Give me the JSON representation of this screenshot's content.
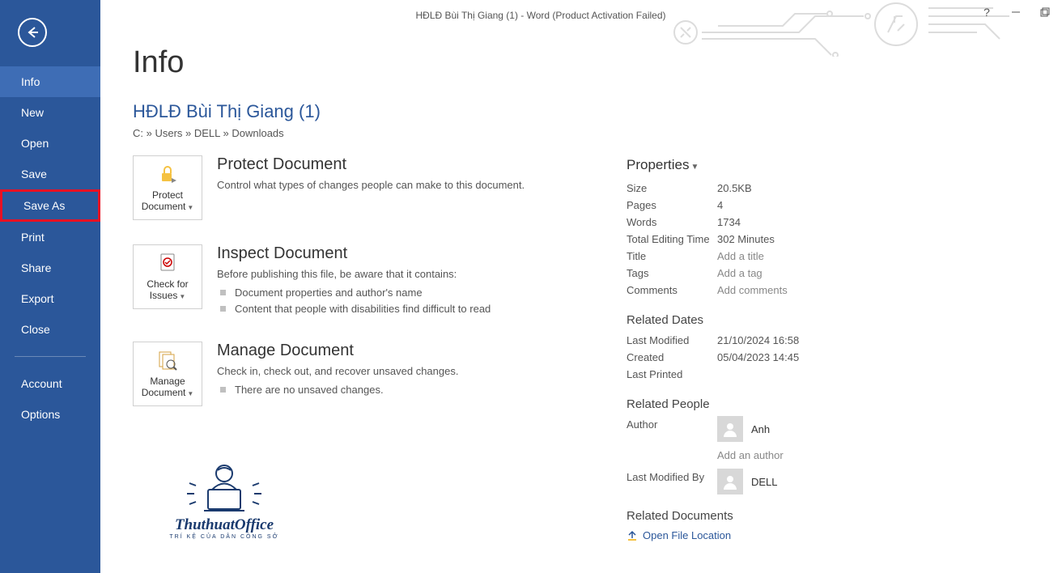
{
  "window_title": "HĐLĐ Bùi Thị Giang (1) - Word (Product Activation Failed)",
  "sidebar": {
    "items": [
      {
        "label": "Info",
        "active": true,
        "hl": false
      },
      {
        "label": "New",
        "active": false,
        "hl": false
      },
      {
        "label": "Open",
        "active": false,
        "hl": false
      },
      {
        "label": "Save",
        "active": false,
        "hl": false
      },
      {
        "label": "Save As",
        "active": false,
        "hl": true
      },
      {
        "label": "Print",
        "active": false,
        "hl": false
      },
      {
        "label": "Share",
        "active": false,
        "hl": false
      },
      {
        "label": "Export",
        "active": false,
        "hl": false
      },
      {
        "label": "Close",
        "active": false,
        "hl": false
      }
    ],
    "footer": [
      {
        "label": "Account"
      },
      {
        "label": "Options"
      }
    ]
  },
  "page": {
    "title": "Info",
    "doc_title": "HĐLĐ Bùi Thị Giang (1)",
    "doc_path": "C: » Users » DELL » Downloads"
  },
  "blocks": {
    "protect": {
      "btn": "Protect\nDocument",
      "title": "Protect Document",
      "desc": "Control what types of changes people can make to this document."
    },
    "inspect": {
      "btn": "Check for\nIssues",
      "title": "Inspect Document",
      "desc": "Before publishing this file, be aware that it contains:",
      "bullets": [
        "Document properties and author's name",
        "Content that people with disabilities find difficult to read"
      ]
    },
    "manage": {
      "btn": "Manage\nDocument",
      "title": "Manage Document",
      "desc": "Check in, check out, and recover unsaved changes.",
      "note": "There are no unsaved changes."
    }
  },
  "props": {
    "header": "Properties",
    "rows": [
      {
        "label": "Size",
        "value": "20.5KB"
      },
      {
        "label": "Pages",
        "value": "4"
      },
      {
        "label": "Words",
        "value": "1734"
      },
      {
        "label": "Total Editing Time",
        "value": "302 Minutes"
      },
      {
        "label": "Title",
        "value": "Add a title",
        "link": true
      },
      {
        "label": "Tags",
        "value": "Add a tag",
        "link": true
      },
      {
        "label": "Comments",
        "value": "Add comments",
        "link": true
      }
    ],
    "dates_header": "Related Dates",
    "dates": [
      {
        "label": "Last Modified",
        "value": "21/10/2024 16:58"
      },
      {
        "label": "Created",
        "value": "05/04/2023 14:45"
      },
      {
        "label": "Last Printed",
        "value": ""
      }
    ],
    "people_header": "Related People",
    "author_label": "Author",
    "author_name": "Anh",
    "add_author": "Add an author",
    "modified_label": "Last Modified By",
    "modified_name": "DELL",
    "docs_header": "Related Documents",
    "open_location": "Open File Location"
  },
  "logo": {
    "text": "ThuthuatOffice",
    "sub": "TRÍ KỆ CỦA DÂN CÔNG SỞ"
  }
}
